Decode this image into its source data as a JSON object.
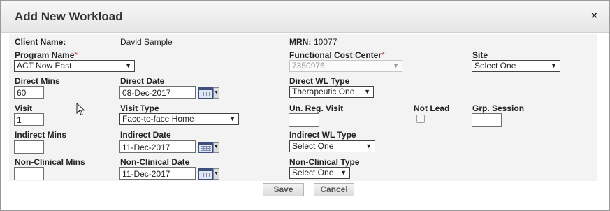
{
  "dialog": {
    "title": "Add New Workload",
    "close_glyph": "×"
  },
  "client": {
    "name_label": "Client Name:",
    "name_value": "David Sample",
    "mrn_label": "MRN:",
    "mrn_value": "10077"
  },
  "program": {
    "label": "Program Name",
    "required_mark": "*",
    "value": "ACT Now East"
  },
  "cost_center": {
    "label": "Functional Cost Center",
    "required_mark": "*",
    "value": "7350976"
  },
  "site": {
    "label": "Site",
    "value": "Select One"
  },
  "direct": {
    "mins_label": "Direct Mins",
    "mins_value": "60",
    "date_label": "Direct Date",
    "date_value": "08-Dec-2017",
    "wl_type_label": "Direct WL Type",
    "wl_type_value": "Therapeutic One"
  },
  "visit": {
    "label": "Visit",
    "value": "1",
    "type_label": "Visit Type",
    "type_value": "Face-to-face Home",
    "unreg_label": "Un. Reg. Visit",
    "unreg_value": "",
    "not_lead_label": "Not Lead",
    "not_lead_checked": false,
    "grp_label": "Grp. Session",
    "grp_value": ""
  },
  "indirect": {
    "mins_label": "Indirect Mins",
    "mins_value": "",
    "date_label": "Indirect Date",
    "date_value": "11-Dec-2017",
    "wl_type_label": "Indirect WL Type",
    "wl_type_value": "Select One"
  },
  "non_clinical": {
    "mins_label": "Non-Clinical Mins",
    "mins_value": "",
    "date_label": "Non-Clinical Date",
    "date_value": "11-Dec-2017",
    "type_label": "Non-Clinical Type",
    "type_value": "Select One"
  },
  "actions": {
    "save_label": "Save",
    "cancel_label": "Cancel"
  },
  "icons": {
    "dropdown": "chevron-down-icon",
    "calendar": "calendar-icon",
    "close": "close-icon"
  }
}
